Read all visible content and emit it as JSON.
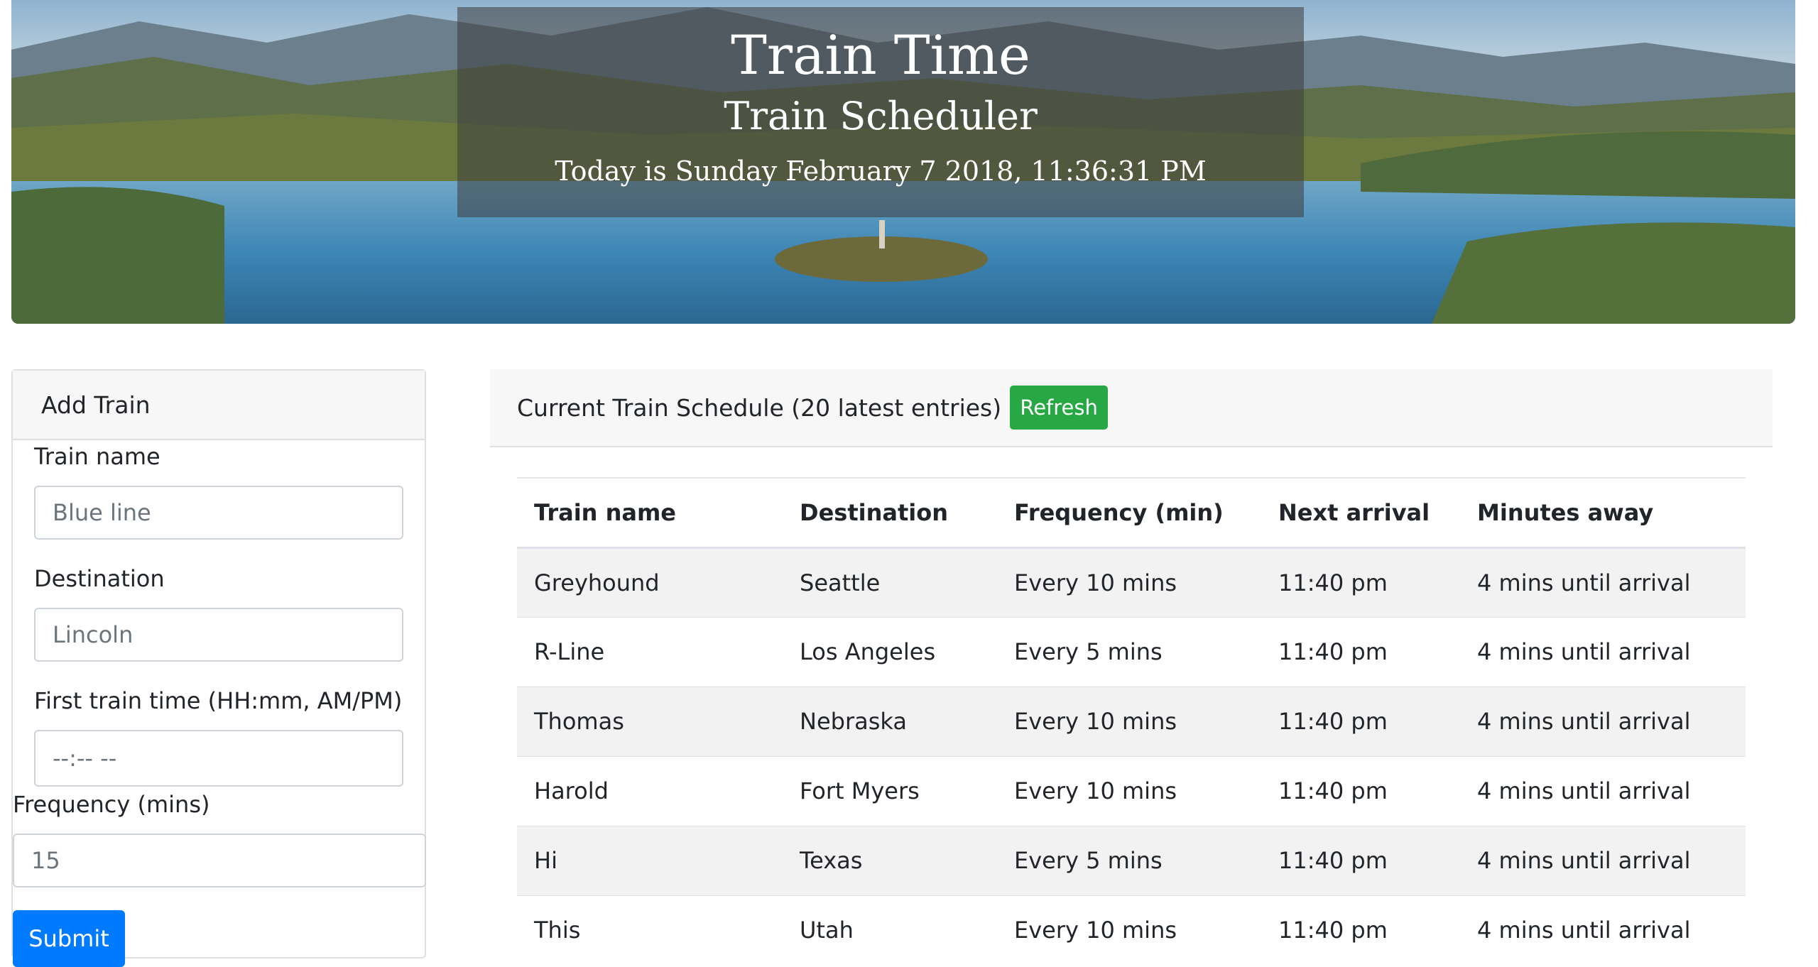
{
  "header": {
    "title": "Train Time",
    "subtitle": "Train Scheduler",
    "date_text": "Today is Sunday February 7 2018, 11:36:31 PM"
  },
  "add_train": {
    "card_title": "Add Train",
    "name_label": "Train name",
    "name_placeholder": "Blue line",
    "destination_label": "Destination",
    "destination_placeholder": "Lincoln",
    "time_label": "First train time (HH:mm, AM/PM)",
    "time_placeholder": "--:-- --",
    "frequency_label": "Frequency (mins)",
    "frequency_placeholder": "15",
    "submit_label": "Submit"
  },
  "schedule": {
    "header_text": "Current Train Schedule (20 latest entries)",
    "refresh_label": "Refresh",
    "columns": [
      "Train name",
      "Destination",
      "Frequency (min)",
      "Next arrival",
      "Minutes away"
    ],
    "rows": [
      [
        "Greyhound",
        "Seattle",
        "Every 10 mins",
        "11:40 pm",
        "4 mins until arrival"
      ],
      [
        "R-Line",
        "Los Angeles",
        "Every 5 mins",
        "11:40 pm",
        "4 mins until arrival"
      ],
      [
        "Thomas",
        "Nebraska",
        "Every 10 mins",
        "11:40 pm",
        "4 mins until arrival"
      ],
      [
        "Harold",
        "Fort Myers",
        "Every 10 mins",
        "11:40 pm",
        "4 mins until arrival"
      ],
      [
        "Hi",
        "Texas",
        "Every 5 mins",
        "11:40 pm",
        "4 mins until arrival"
      ],
      [
        "This",
        "Utah",
        "Every 10 mins",
        "11:40 pm",
        "4 mins until arrival"
      ]
    ]
  },
  "colors": {
    "submit": "#007bff",
    "refresh": "#28a745",
    "striped_row": "#f2f2f2"
  }
}
